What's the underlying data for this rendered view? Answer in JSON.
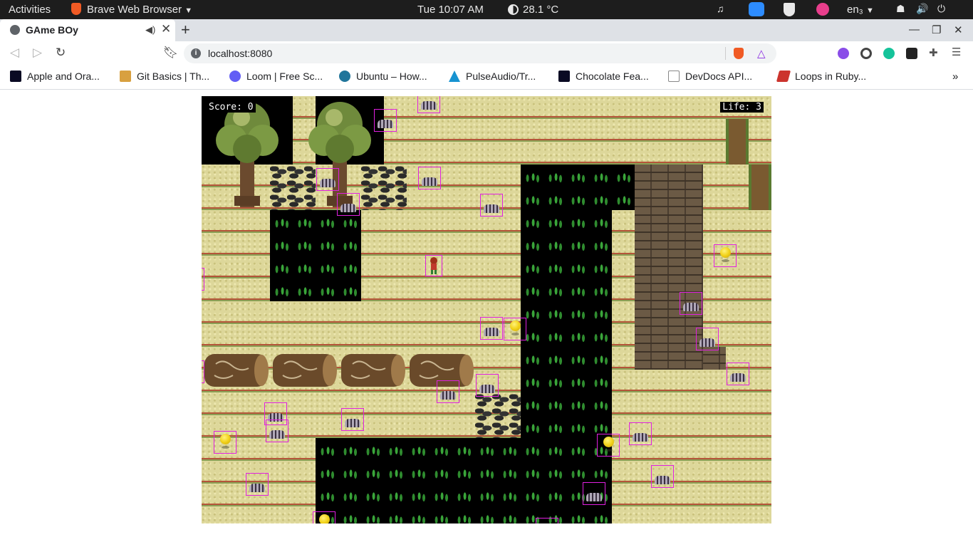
{
  "topbar": {
    "activities": "Activities",
    "app_name": "Brave Web Browser",
    "clock": "Tue 10:07 AM",
    "weather": "28.1 °C",
    "keyboard_layout": "en₃"
  },
  "browser": {
    "tab_title": "GAme BOy",
    "url": "localhost:8080",
    "bookmarks": [
      {
        "label": "Apple and Ora...",
        "icon": "freecodecamp-icon",
        "color": "#0a0a23"
      },
      {
        "label": "Git Basics | Th...",
        "icon": "odin-project-icon",
        "color": "#d8a040"
      },
      {
        "label": "Loom | Free Sc...",
        "icon": "loom-icon",
        "color": "#625df5"
      },
      {
        "label": "Ubuntu – How...",
        "icon": "wordpress-icon",
        "color": "#21759b"
      },
      {
        "label": "PulseAudio/Tr...",
        "icon": "arch-icon",
        "color": "#1793d1"
      },
      {
        "label": "Chocolate Fea...",
        "icon": "freecodecamp-icon",
        "color": "#0a0a23"
      },
      {
        "label": "DevDocs API...",
        "icon": "devdocs-icon",
        "color": "#888888"
      },
      {
        "label": "Loops in Ruby...",
        "icon": "ruby-icon",
        "color": "#cc342d"
      }
    ]
  },
  "game": {
    "score_label": "Score: 0",
    "life_label": "Life: 3",
    "score": 0,
    "life": 3
  },
  "colors": {
    "topbar_bg": "#1d1d1d",
    "tabstrip_bg": "#dee1e6",
    "hitbox_outline": "#e020e0",
    "sand": "#ddd79a",
    "grass": "#2f8c2f"
  }
}
